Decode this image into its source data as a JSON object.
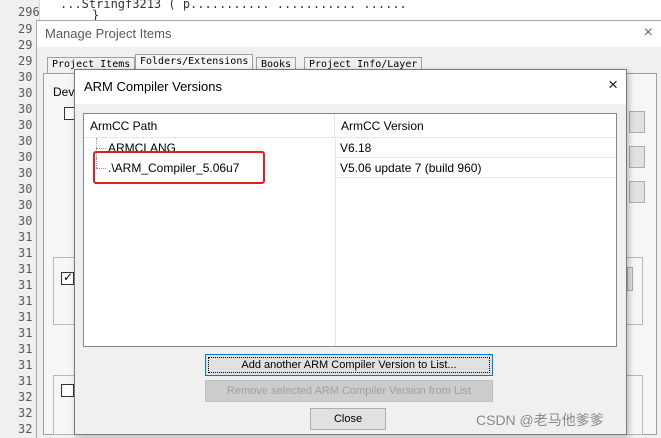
{
  "editor": {
    "line_numbers": [
      "296",
      "29",
      "29",
      "29",
      "30",
      "30",
      "30",
      "30",
      "30",
      "30",
      "30",
      "30",
      "30",
      "30",
      "31",
      "31",
      "31",
      "31",
      "31",
      "31",
      "31",
      "31",
      "31",
      "31",
      "32",
      "32",
      "32"
    ],
    "code_fragment": "...Stringf3213 ( p...........  ...........  ......",
    "code_brace": "}"
  },
  "manage_dialog": {
    "title": "Manage Project Items",
    "close_label": "×",
    "tabs": [
      "Project Items",
      "Folders/Extensions",
      "Books",
      "Project Info/Layer"
    ],
    "device_label": "Devi"
  },
  "arm_dialog": {
    "title": "ARM Compiler Versions",
    "close_label": "×",
    "columns": {
      "path": "ArmCC Path",
      "version": "ArmCC Version"
    },
    "rows": [
      {
        "path": "ARMCLANG",
        "version": "V6.18"
      },
      {
        "path": ".\\ARM_Compiler_5.06u7",
        "version": "V5.06 update 7 (build 960)"
      }
    ],
    "buttons": {
      "add": "Add another ARM Compiler Version to List...",
      "remove": "Remove selected ARM Compiler Version from List",
      "close": "Close"
    }
  },
  "watermark": "CSDN @老马他爹爹",
  "colors": {
    "highlight": "#e02020",
    "focus_border": "#0078d7"
  }
}
